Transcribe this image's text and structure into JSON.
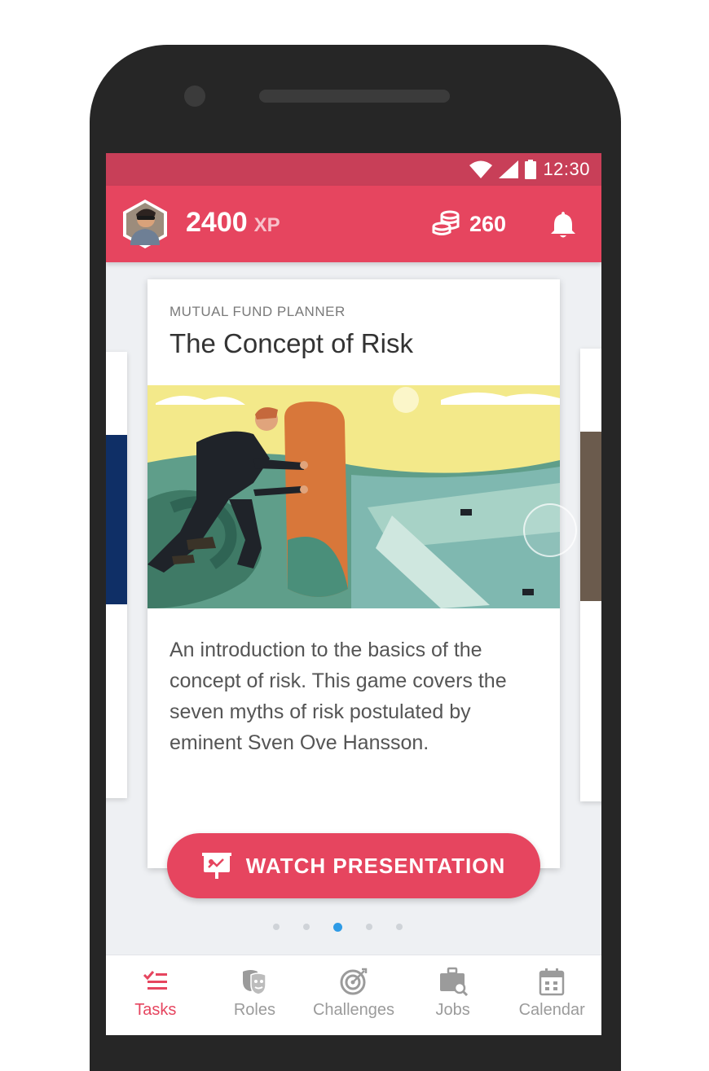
{
  "status_bar": {
    "time": "12:30",
    "icons": [
      "wifi-icon",
      "signal-icon",
      "battery-icon"
    ]
  },
  "header": {
    "xp_value": "2400",
    "xp_unit": "XP",
    "coins": "260",
    "icons": [
      "avatar",
      "coins-icon",
      "bell-icon"
    ]
  },
  "card": {
    "eyebrow": "MUTUAL FUND PLANNER",
    "title": "The Concept of Risk",
    "description": "An introduction to the basics of the concept of risk. This game covers the seven myths of risk postulated by eminent Sven Ove Hansson."
  },
  "cta": {
    "label": "WATCH PRESENTATION",
    "icon": "presentation-icon"
  },
  "pager": {
    "count": 5,
    "active_index": 2
  },
  "bottom_nav": {
    "items": [
      {
        "label": "Tasks",
        "icon": "tasks-icon",
        "active": true
      },
      {
        "label": "Roles",
        "icon": "masks-icon",
        "active": false
      },
      {
        "label": "Challenges",
        "icon": "target-icon",
        "active": false
      },
      {
        "label": "Jobs",
        "icon": "briefcase-search-icon",
        "active": false
      },
      {
        "label": "Calendar",
        "icon": "calendar-icon",
        "active": false
      }
    ]
  },
  "colors": {
    "primary": "#e6455f",
    "status_bar": "#c83f58",
    "active_dot": "#2e9be6"
  }
}
